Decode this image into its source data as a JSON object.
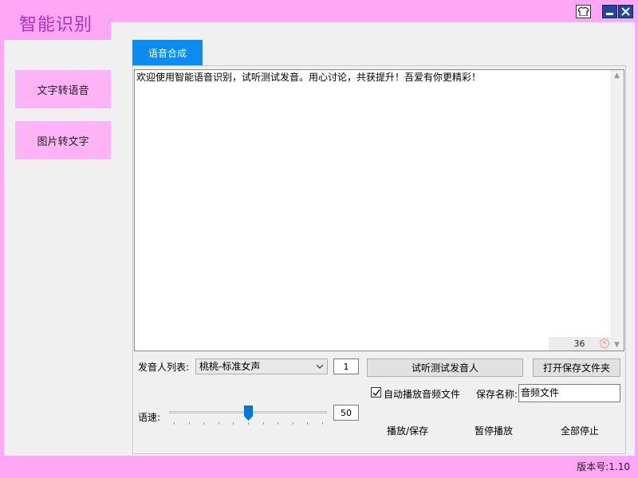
{
  "app": {
    "title": "智能识别",
    "version": "版本号:1.10"
  },
  "window_controls": {
    "skin_icon": "shirt-icon",
    "minimize_icon": "minimize-icon",
    "close_icon": "close-icon"
  },
  "sidebar": {
    "items": [
      {
        "label": "文字转语音"
      },
      {
        "label": "图片转文字"
      }
    ]
  },
  "tabs": [
    {
      "label": "语音合成",
      "active": true
    }
  ],
  "editor": {
    "text": "欢迎使用智能语音识别，试听测试发音。用心讨论，共获提升！吾爱有你更精彩！",
    "char_count": "36"
  },
  "voice": {
    "label": "发音人列表:",
    "selected": "桃桃-标准女声",
    "count": "1",
    "preview_button": "试听测试发音人",
    "open_folder_button": "打开保存文件夹"
  },
  "options": {
    "auto_play_label": "自动播放音频文件",
    "auto_play_checked": true,
    "save_name_label": "保存名称:",
    "save_name_value": "音频文件"
  },
  "speed": {
    "label": "语速:",
    "value": "50",
    "fraction": 0.5
  },
  "actions": {
    "play_save": "播放/保存",
    "pause": "暂停播放",
    "stop_all": "全部停止"
  },
  "colors": {
    "frame": "#ffa6f5",
    "accent": "#0a8cf0",
    "title_text": "#b030c8"
  }
}
